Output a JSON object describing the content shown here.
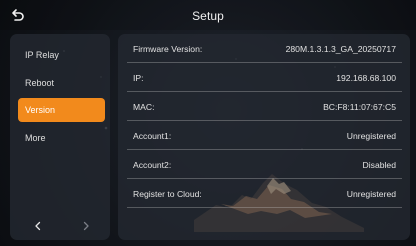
{
  "header": {
    "title": "Setup",
    "back_icon": "back-icon"
  },
  "sidebar": {
    "items": [
      {
        "label": "IP Relay"
      },
      {
        "label": "Reboot"
      },
      {
        "label": "Version"
      },
      {
        "label": "More"
      }
    ],
    "active_item": "Version",
    "prev_icon": "chevron-left-icon",
    "next_icon": "chevron-right-icon"
  },
  "details": {
    "rows": [
      {
        "label": "Firmware Version:",
        "value": "280M.1.3.1.3_GA_20250717"
      },
      {
        "label": "IP:",
        "value": "192.168.68.100"
      },
      {
        "label": "MAC:",
        "value": "BC:F8:11:07:67:C5"
      },
      {
        "label": "Account1:",
        "value": "Unregistered"
      },
      {
        "label": "Account2:",
        "value": "Disabled"
      },
      {
        "label": "Register to Cloud:",
        "value": "Unregistered"
      }
    ]
  },
  "colors": {
    "accent": "#f28a1c",
    "panel": "#222730",
    "background": "#11151b",
    "divider": "#8d8d8d"
  }
}
